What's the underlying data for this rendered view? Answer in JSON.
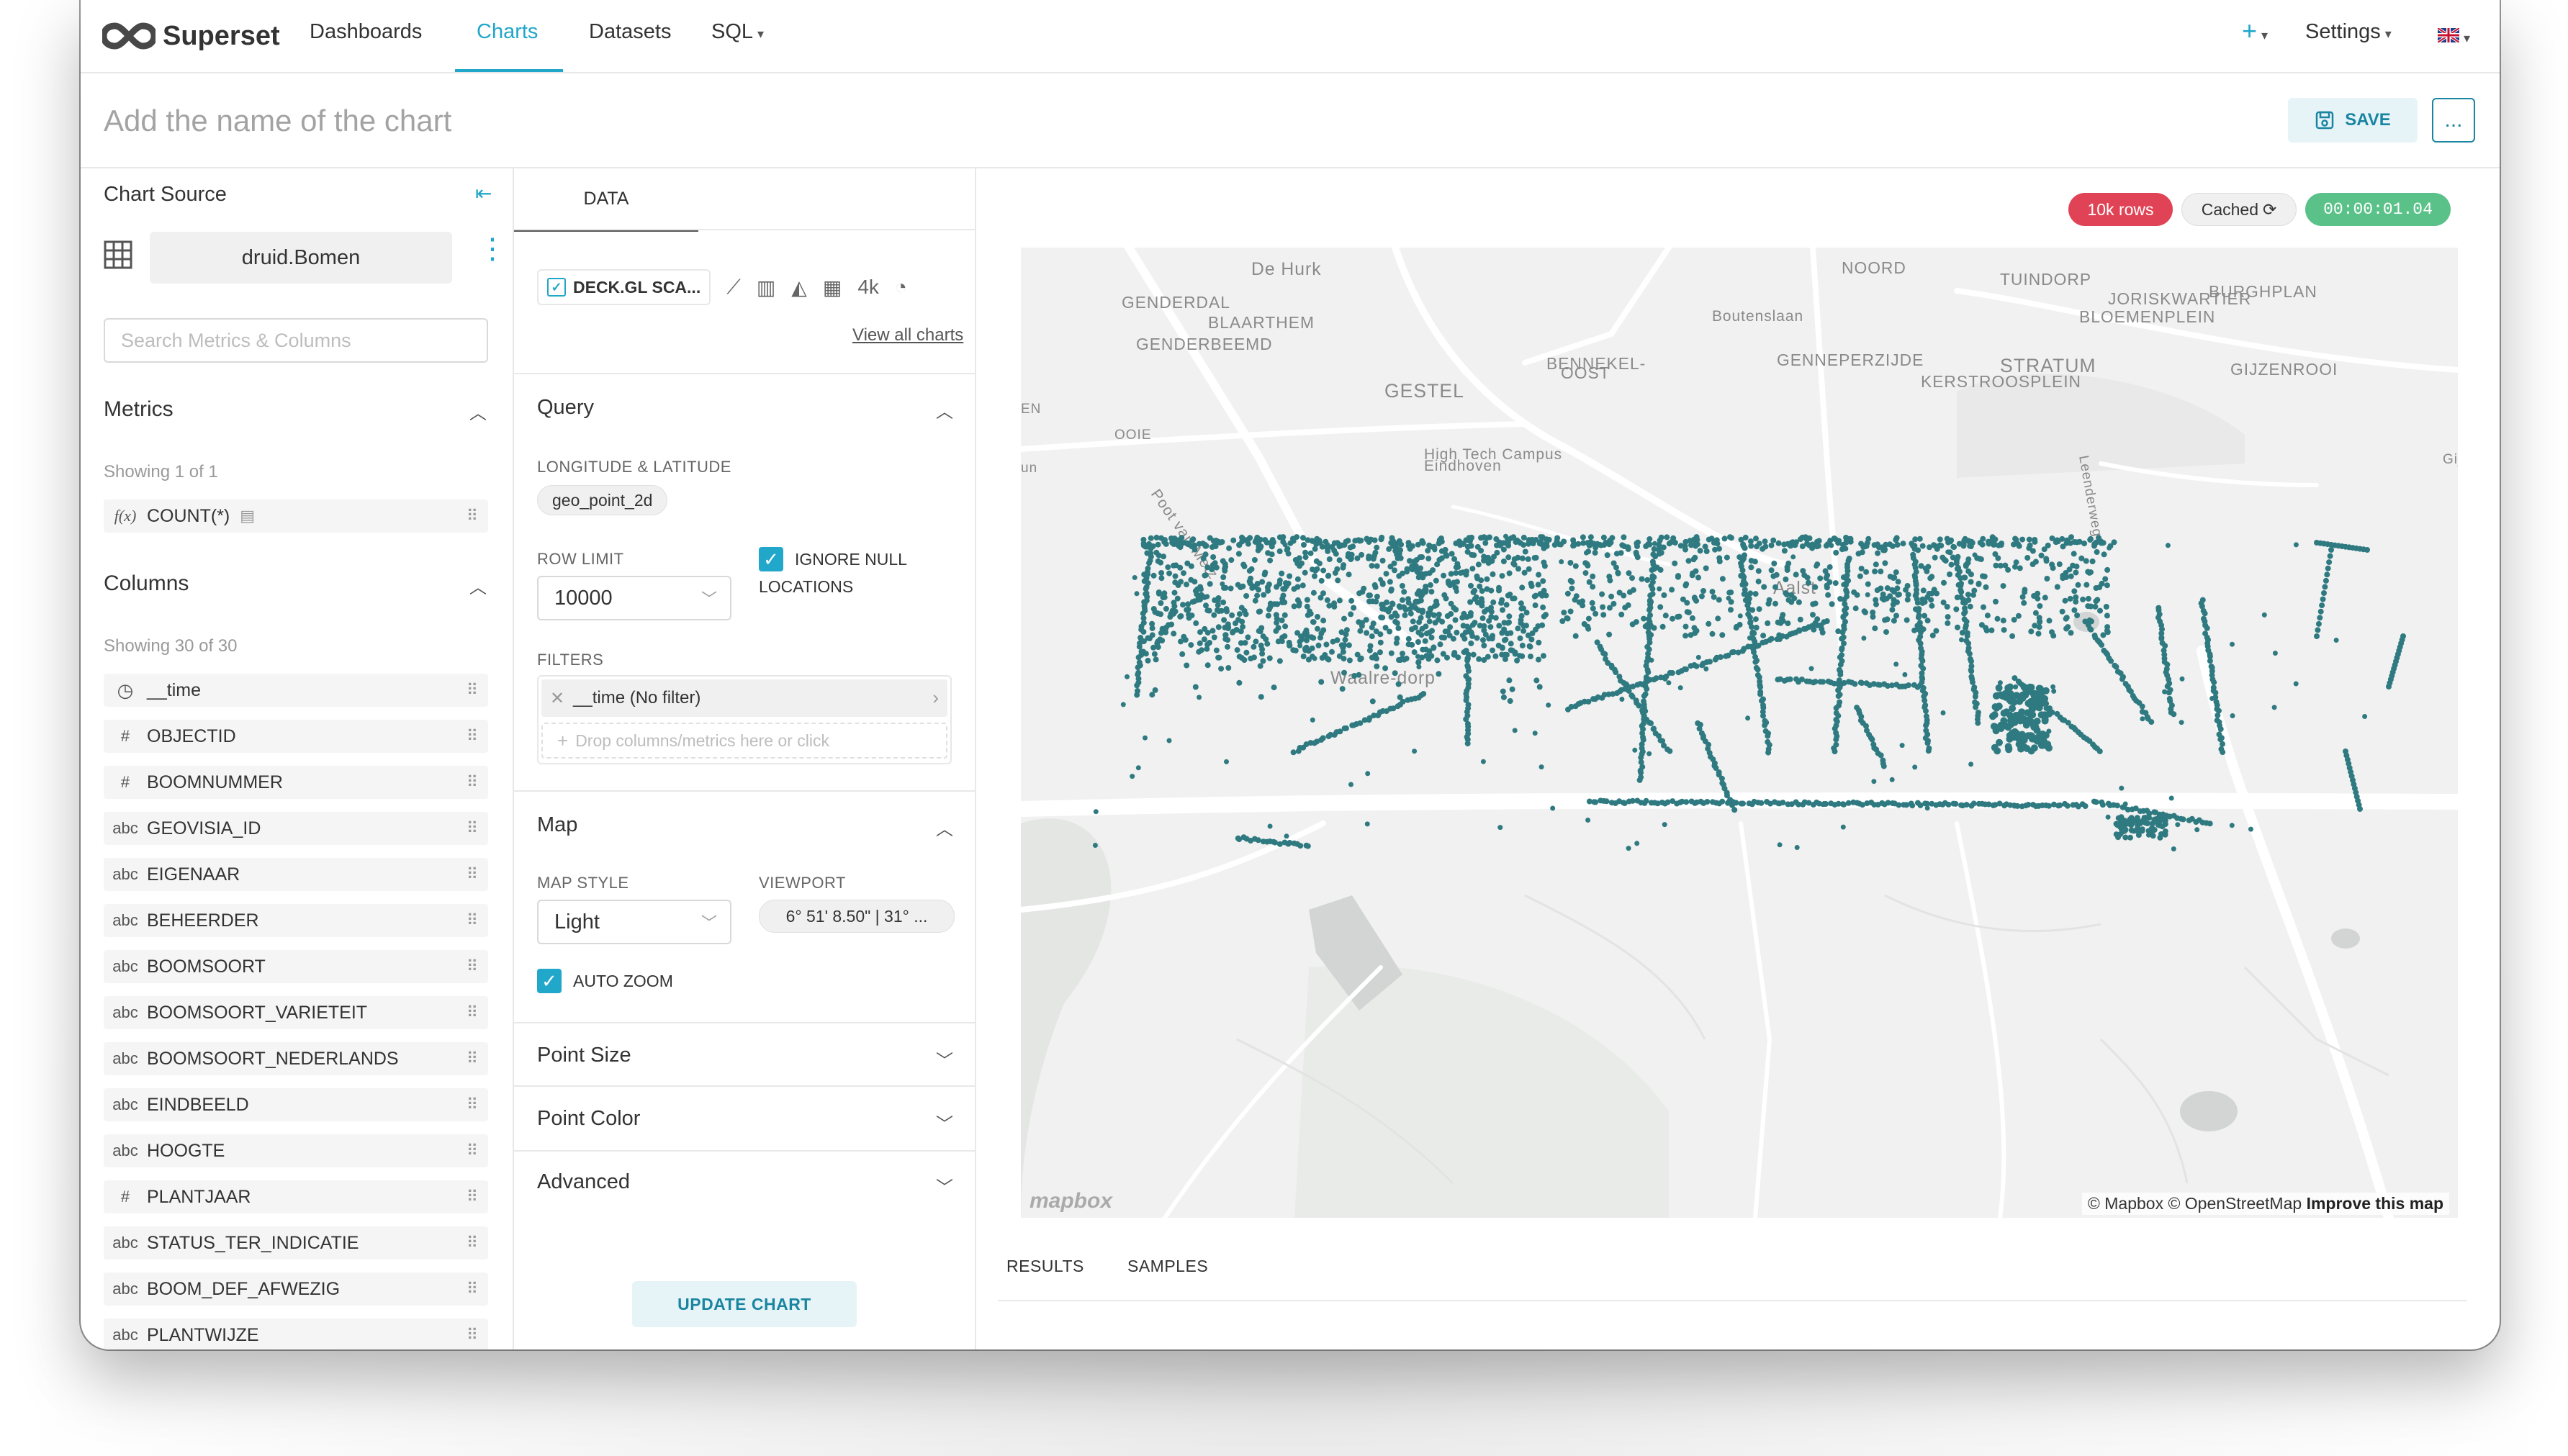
{
  "nav": {
    "brand": "Superset",
    "items": [
      "Dashboards",
      "Charts",
      "Datasets",
      "SQL"
    ],
    "plus": "+",
    "settings": "Settings"
  },
  "header": {
    "chart_name_placeholder": "Add the name of the chart",
    "save": "SAVE",
    "more": "..."
  },
  "datasource": {
    "title": "Chart Source",
    "name": "druid.Bomen",
    "search_placeholder": "Search Metrics & Columns",
    "metrics_title": "Metrics",
    "metrics_showing": "Showing 1 of 1",
    "metrics": [
      {
        "type": "f(x)",
        "name": "COUNT(*)"
      }
    ],
    "columns_title": "Columns",
    "columns_showing": "Showing 30 of 30",
    "columns": [
      {
        "type": "time",
        "name": "__time"
      },
      {
        "type": "#",
        "name": "OBJECTID"
      },
      {
        "type": "#",
        "name": "BOOMNUMMER"
      },
      {
        "type": "abc",
        "name": "GEOVISIA_ID"
      },
      {
        "type": "abc",
        "name": "EIGENAAR"
      },
      {
        "type": "abc",
        "name": "BEHEERDER"
      },
      {
        "type": "abc",
        "name": "BOOMSOORT"
      },
      {
        "type": "abc",
        "name": "BOOMSOORT_VARIETEIT"
      },
      {
        "type": "abc",
        "name": "BOOMSOORT_NEDERLANDS"
      },
      {
        "type": "abc",
        "name": "EINDBEELD"
      },
      {
        "type": "abc",
        "name": "HOOGTE"
      },
      {
        "type": "#",
        "name": "PLANTJAAR"
      },
      {
        "type": "abc",
        "name": "STATUS_TER_INDICATIE"
      },
      {
        "type": "abc",
        "name": "BOOM_DEF_AFWEZIG"
      },
      {
        "type": "abc",
        "name": "PLANTWIJZE"
      }
    ]
  },
  "controls": {
    "tab": "DATA",
    "viz_type": "DECK.GL SCA...",
    "viz_4k": "4k",
    "view_all": "View all charts",
    "query_title": "Query",
    "lonlat_label": "LONGITUDE & LATITUDE",
    "lonlat_value": "geo_point_2d",
    "row_limit_label": "ROW LIMIT",
    "row_limit_value": "10000",
    "ignore_null_1": "IGNORE NULL",
    "ignore_null_2": "LOCATIONS",
    "filters_label": "FILTERS",
    "filter_value": "__time (No filter)",
    "filter_drop": "Drop columns/metrics here or click",
    "map_title": "Map",
    "map_style_label": "MAP STYLE",
    "map_style_value": "Light",
    "viewport_label": "VIEWPORT",
    "viewport_value": "6° 51' 8.50\" | 31° ...",
    "auto_zoom": "AUTO ZOOM",
    "point_size": "Point Size",
    "point_color": "Point Color",
    "advanced": "Advanced",
    "update": "UPDATE CHART"
  },
  "result": {
    "rows_badge": "10k rows",
    "cached_badge": "Cached",
    "time_badge": "00:00:01.04",
    "attribution": "© Mapbox © OpenStreetMap",
    "improve": "Improve this map",
    "mapbox_logo": "mapbox",
    "tab_results": "RESULTS",
    "tab_samples": "SAMPLES",
    "point_color": "#2f7a80"
  },
  "map_labels": [
    "De Hurk",
    "NOORD",
    "TUINDORP",
    "BURGHPLAN",
    "JORISKWARTIER",
    "BLOEMENPLEIN",
    "GENDERDAL",
    "Boutenslaan",
    "BLAARTHEM",
    "GENDERBEEMD",
    "GENNEPERZIJDE",
    "STRATUM",
    "GIJZENROOI",
    "BENNEKEL-",
    "OOST",
    "KERSTROOSPLEIN",
    "GESTEL",
    "High Tech Campus",
    "Eindhoven",
    "Poot van Metz",
    "Leenderweg",
    "Aalst",
    "Waalre-dorp",
    "EN",
    "un",
    "OOIE",
    "Gij"
  ]
}
